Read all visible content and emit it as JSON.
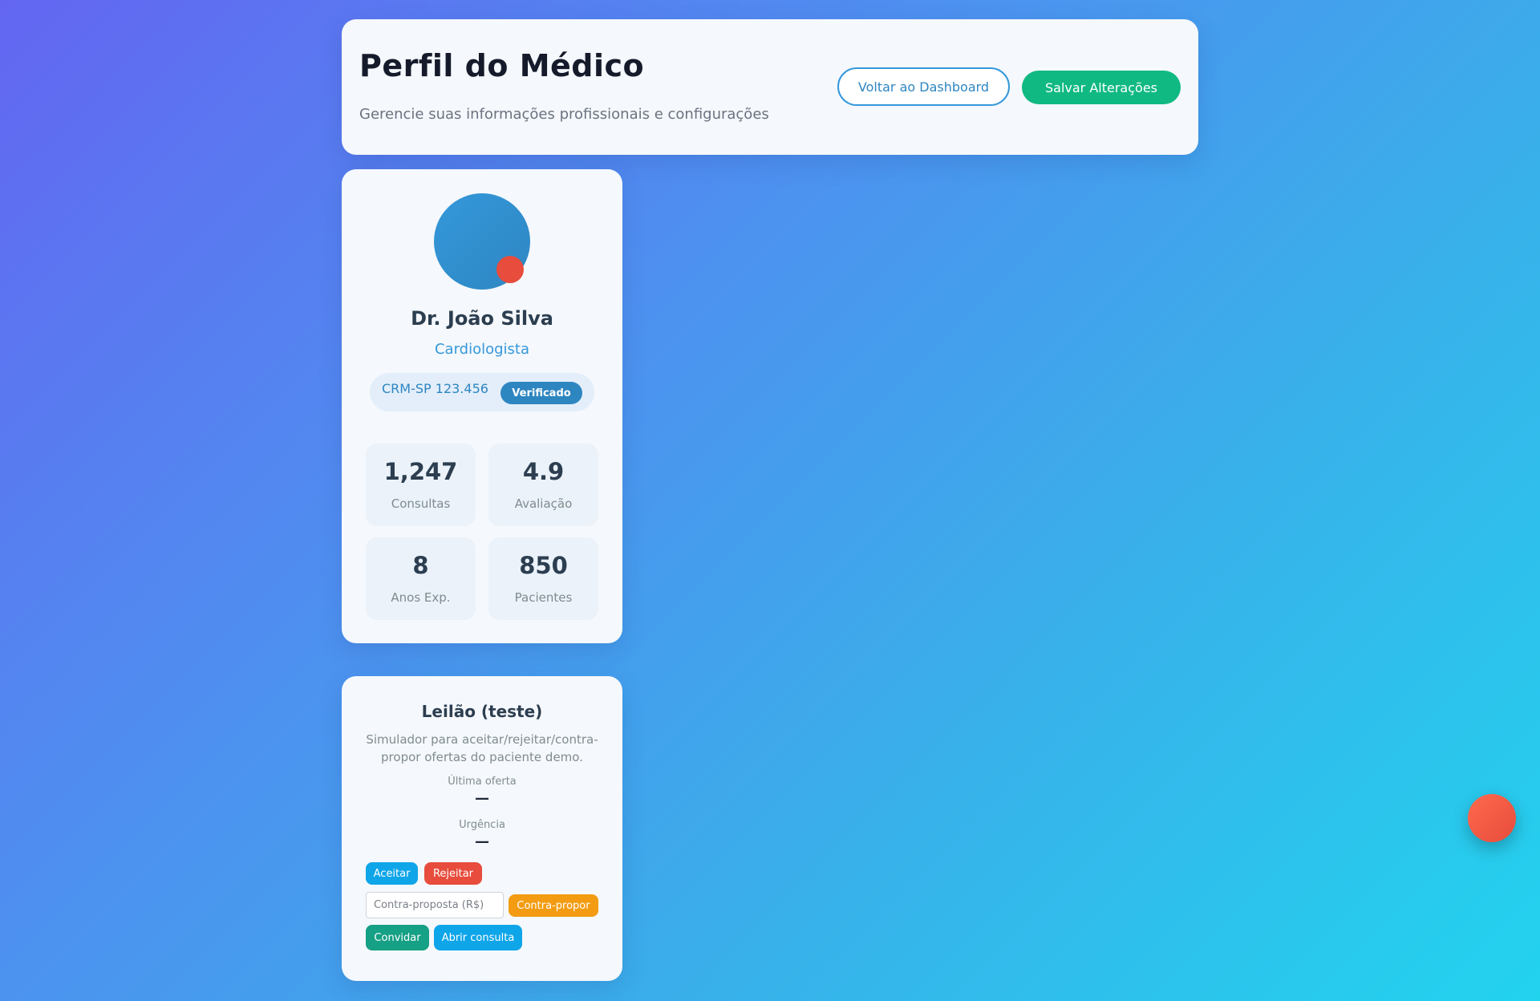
{
  "header": {
    "title": "Perfil do Médico",
    "subtitle": "Gerencie suas informações profissionais e configurações",
    "back_label": "Voltar ao Dashboard",
    "save_label": "Salvar Alterações"
  },
  "profile": {
    "name": "Dr. João Silva",
    "specialty": "Cardiologista",
    "crm": "CRM-SP 123.456",
    "verified_label": "Verificado",
    "stats": [
      {
        "value": "1,247",
        "label": "Consultas"
      },
      {
        "value": "4.9",
        "label": "Avaliação"
      },
      {
        "value": "8",
        "label": "Anos Exp."
      },
      {
        "value": "850",
        "label": "Pacientes"
      }
    ]
  },
  "auction": {
    "title": "Leilão (teste)",
    "description": "Simulador para aceitar/rejeitar/contra-propor ofertas do paciente demo.",
    "last_offer_label": "Última oferta",
    "last_offer_value": "—",
    "urgency_label": "Urgência",
    "urgency_value": "—",
    "accept_label": "Aceitar",
    "reject_label": "Rejeitar",
    "counter_placeholder": "Contra-proposta (R$)",
    "counter_label": "Contra-propor",
    "invite_label": "Convidar",
    "open_label": "Abrir consulta"
  },
  "colors": {
    "accent_blue": "#3498db",
    "success_green": "#10b981",
    "danger_red": "#e74c3c",
    "warning_orange": "#f39c12",
    "teal": "#16a085",
    "sky": "#0ea5e9"
  }
}
